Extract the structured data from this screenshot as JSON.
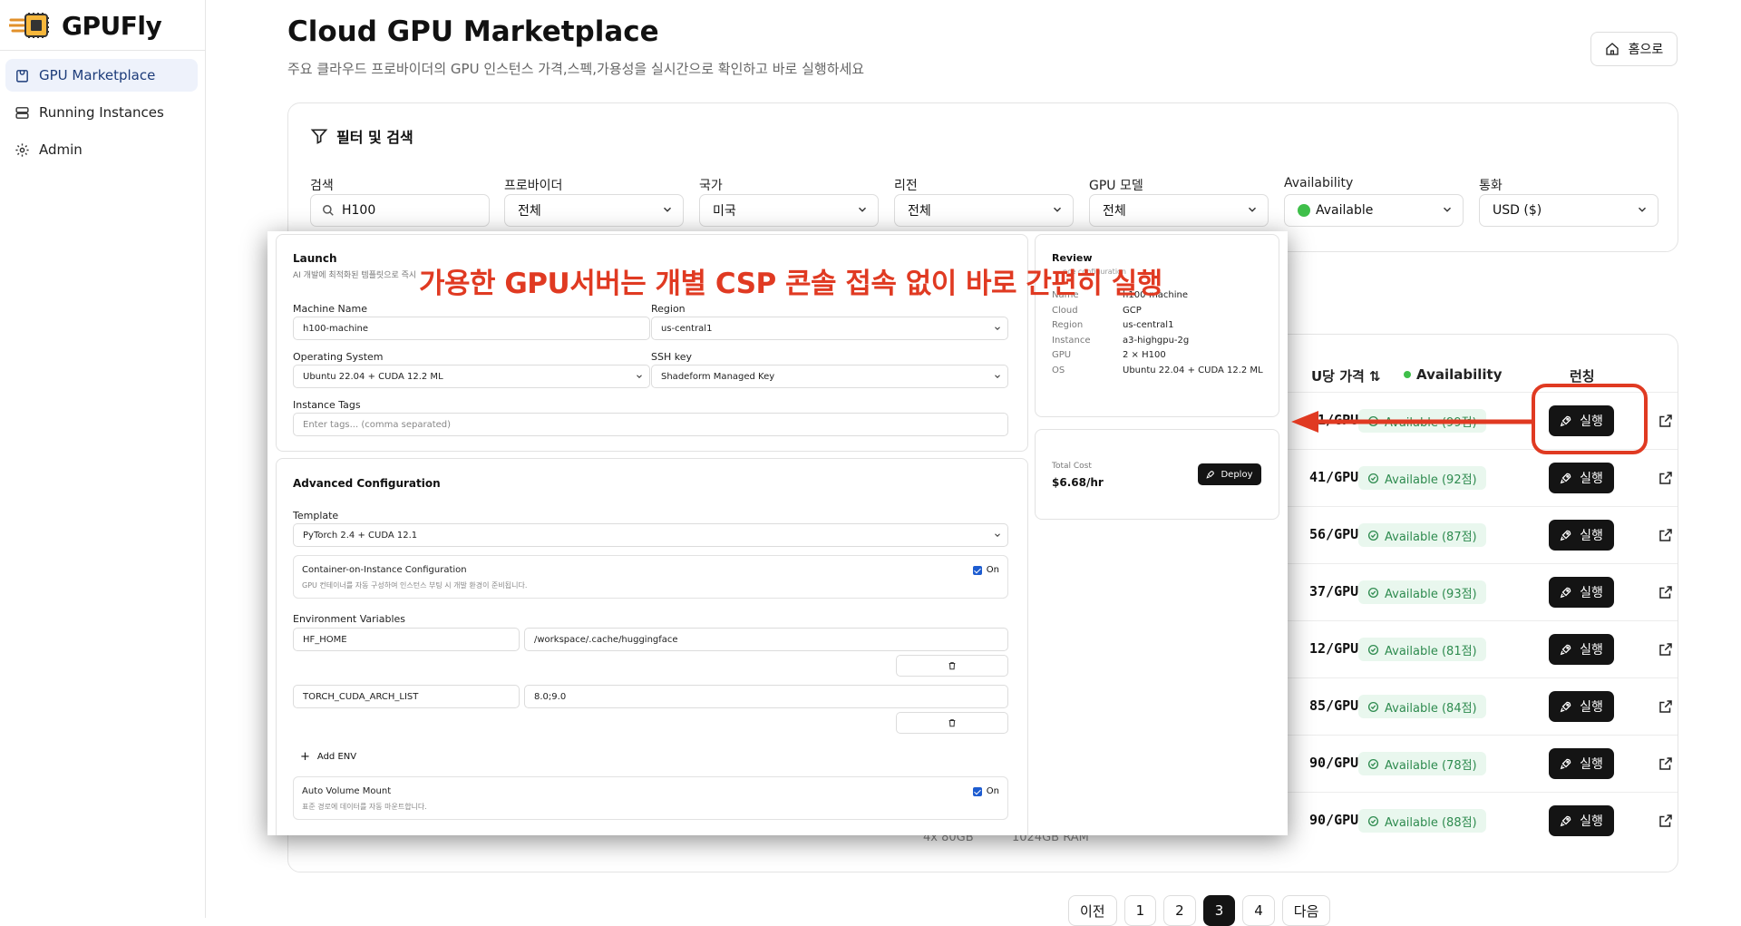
{
  "app": {
    "name": "GPUFly"
  },
  "sidebar": {
    "items": [
      {
        "label": "GPU Marketplace",
        "icon": "store-icon",
        "active": true
      },
      {
        "label": "Running Instances",
        "icon": "server-icon"
      },
      {
        "label": "Admin",
        "icon": "gear-icon"
      }
    ]
  },
  "header": {
    "title": "Cloud GPU Marketplace",
    "subtitle": "주요 클라우드 프로바이더의 GPU 인스턴스 가격,스펙,가용성을 실시간으로 확인하고 바로 실행하세요",
    "home_label": "홈으로"
  },
  "filters": {
    "title": "필터 및 검색",
    "fields": [
      {
        "label": "검색",
        "value": "H100"
      },
      {
        "label": "프로바이더",
        "value": "전체"
      },
      {
        "label": "국가",
        "value": "미국"
      },
      {
        "label": "리전",
        "value": "전체"
      },
      {
        "label": "GPU 모델",
        "value": "전체"
      },
      {
        "label": "Availability",
        "value": "Available"
      },
      {
        "label": "통화",
        "value": "USD ($)"
      }
    ]
  },
  "table": {
    "headers": {
      "price": "U당 가격 ⇅",
      "availability": "Availability",
      "launch": "런칭"
    },
    "rows": [
      {
        "price": "41/GPU·h",
        "availability": "Available (99점)",
        "action": "실행"
      },
      {
        "price": "41/GPU·h",
        "availability": "Available (92점)",
        "action": "실행"
      },
      {
        "price": "56/GPU·h",
        "availability": "Available (87점)",
        "action": "실행"
      },
      {
        "price": "37/GPU·h",
        "availability": "Available (93점)",
        "action": "실행"
      },
      {
        "price": "12/GPU·h",
        "availability": "Available (81점)",
        "action": "실행"
      },
      {
        "price": "85/GPU·h",
        "availability": "Available (84점)",
        "action": "실행"
      },
      {
        "price": "90/GPU·h",
        "availability": "Available (78점)",
        "action": "실행"
      },
      {
        "price": "90/GPU·h",
        "availability": "Available (88점)",
        "action": "실행"
      }
    ],
    "partial_row": {
      "gpu": "4x 80GB",
      "ram": "1024GB RAM"
    }
  },
  "pagination": {
    "prev": "이전",
    "pages": [
      "1",
      "2",
      "3",
      "4"
    ],
    "current": "3",
    "next": "다음"
  },
  "launch_dialog": {
    "launch": {
      "title": "Launch",
      "subtitle": "AI 개발에 최적화된 템플릿으로 즉시",
      "machine_name_label": "Machine Name",
      "machine_name": "h100-machine",
      "region_label": "Region",
      "region": "us-central1",
      "os_label": "Operating System",
      "os": "Ubuntu 22.04 + CUDA 12.2 ML",
      "ssh_label": "SSH key",
      "ssh": "Shadeform Managed Key",
      "tags_label": "Instance Tags",
      "tags_placeholder": "Enter tags... (comma separated)"
    },
    "advanced": {
      "title": "Advanced Configuration",
      "template_label": "Template",
      "template": "PyTorch 2.4 + CUDA 12.1",
      "container_title": "Container-on-Instance Configuration",
      "container_desc": "GPU 컨테이너를 자동 구성하여 인스턴스 부팅 시 개발 환경이 준비됩니다.",
      "container_toggle": "On",
      "env_label": "Environment Variables",
      "env": [
        {
          "key": "HF_HOME",
          "value": "/workspace/.cache/huggingface"
        },
        {
          "key": "TORCH_CUDA_ARCH_LIST",
          "value": "8.0;9.0"
        }
      ],
      "add_env": "Add ENV",
      "volume_title": "Auto Volume Mount",
      "volume_desc": "표준 경로에 데이터를 자동 마운트합니다.",
      "volume_toggle": "On"
    },
    "review": {
      "title": "Review",
      "subtitle": "nce configuration",
      "items": [
        {
          "k": "Name",
          "v": "h100-machine"
        },
        {
          "k": "Cloud",
          "v": "GCP"
        },
        {
          "k": "Region",
          "v": "us-central1"
        },
        {
          "k": "Instance",
          "v": "a3-highgpu-2g"
        },
        {
          "k": "GPU",
          "v": "2 × H100"
        },
        {
          "k": "OS",
          "v": "Ubuntu 22.04 + CUDA 12.2 ML"
        }
      ]
    },
    "cost": {
      "label": "Total Cost",
      "value": "$6.68/hr",
      "deploy": "Deploy"
    }
  },
  "annotation": {
    "caption": "가용한 GPU서버는 개별 CSP 콘솔 접속 없이 바로 간편히 실행",
    "color": "#e03a22"
  }
}
